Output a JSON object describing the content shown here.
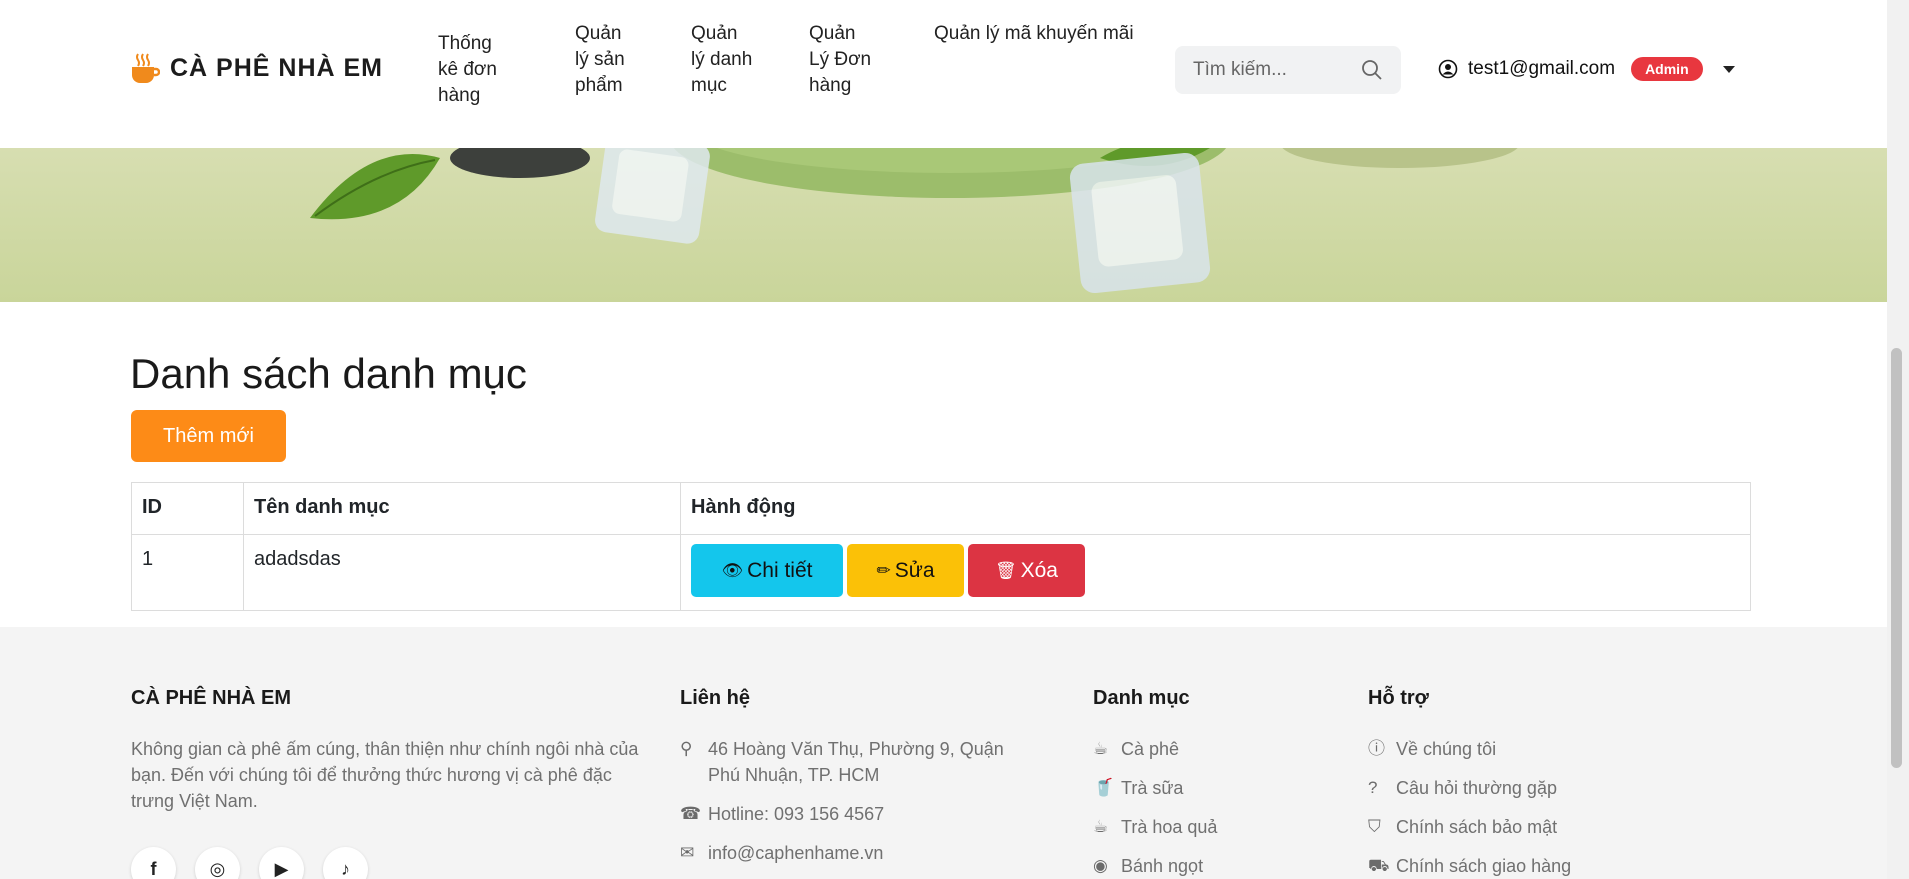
{
  "header": {
    "brand": "CÀ PHÊ NHÀ EM",
    "nav": [
      {
        "lines": [
          "Thống",
          "kê đơn",
          "hàng"
        ]
      },
      {
        "lines": [
          "Quản",
          "lý sản",
          "phẩm"
        ]
      },
      {
        "lines": [
          "Quản",
          "lý danh",
          "mục"
        ]
      },
      {
        "lines": [
          "Quản",
          "Lý Đơn",
          "hàng"
        ]
      },
      {
        "lines": [
          "Quản lý mã khuyến mãi"
        ]
      }
    ],
    "search_placeholder": "Tìm kiếm...",
    "user_email": "test1@gmail.com",
    "role_badge": "Admin"
  },
  "main": {
    "title": "Danh sách danh mục",
    "add_button": "Thêm mới",
    "table": {
      "columns": [
        "ID",
        "Tên danh mục",
        "Hành động"
      ],
      "rows": [
        {
          "id": "1",
          "name": "adadsdas"
        }
      ],
      "actions": {
        "view": "Chi tiết",
        "edit": "Sửa",
        "delete": "Xóa"
      }
    }
  },
  "footer": {
    "brand": {
      "title": "CÀ PHÊ NHÀ EM",
      "desc": "Không gian cà phê ấm cúng, thân thiện như chính ngôi nhà của bạn. Đến với chúng tôi để thưởng thức hương vị cà phê đặc trưng Việt Nam."
    },
    "contact": {
      "title": "Liên hệ",
      "address": "46 Hoàng Văn Thụ, Phường 9, Quận Phú Nhuận, TP. HCM",
      "hotline": "Hotline: 093 156 4567",
      "email": "info@caphenhame.vn"
    },
    "categories": {
      "title": "Danh mục",
      "items": [
        "Cà phê",
        "Trà sữa",
        "Trà hoa quả",
        "Bánh ngọt"
      ]
    },
    "support": {
      "title": "Hỗ trợ",
      "items": [
        "Về chúng tôi",
        "Câu hỏi thường gặp",
        "Chính sách bảo mật",
        "Chính sách giao hàng"
      ]
    }
  },
  "colors": {
    "accent": "#fd8b17",
    "view": "#14c6ec",
    "edit": "#fbc107",
    "delete": "#dc3443",
    "badge": "#e8373f"
  }
}
